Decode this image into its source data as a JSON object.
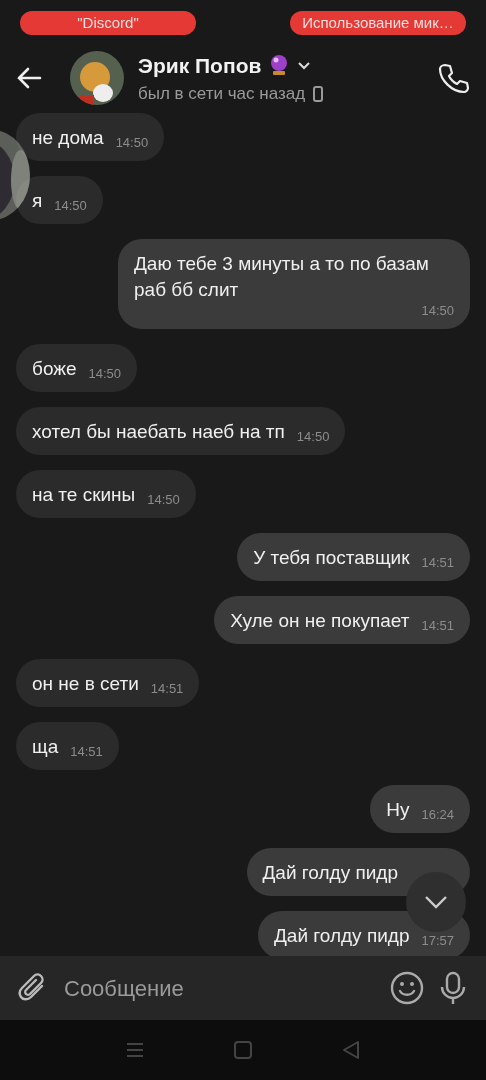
{
  "status_pills": [
    "\"Discord\"",
    "Использование мик…"
  ],
  "header": {
    "name": "Эрик Попов",
    "status": "был в сети час назад"
  },
  "messages": [
    {
      "text": "не дома",
      "time": "14:50",
      "outgoing": false
    },
    {
      "text": "я",
      "time": "14:50",
      "outgoing": false
    },
    {
      "text": "Даю тебе 3 минуты а то по базам раб бб слит",
      "time": "14:50",
      "outgoing": true
    },
    {
      "text": "боже",
      "time": "14:50",
      "outgoing": false
    },
    {
      "text": "хотел бы наебать наеб на тп",
      "time": "14:50",
      "outgoing": false
    },
    {
      "text": "на те скины",
      "time": "14:50",
      "outgoing": false
    },
    {
      "text": "У тебя поставщик",
      "time": "14:51",
      "outgoing": true
    },
    {
      "text": "Хуле он не покупает",
      "time": "14:51",
      "outgoing": true
    },
    {
      "text": "он не в сети",
      "time": "14:51",
      "outgoing": false
    },
    {
      "text": "ща",
      "time": "14:51",
      "outgoing": false
    },
    {
      "text": "Ну",
      "time": "16:24",
      "outgoing": true
    },
    {
      "text": "Дай голду пидр",
      "outgoing": true
    },
    {
      "text": "Дай голду пидр",
      "time": "17:57",
      "outgoing": true
    }
  ],
  "composer": {
    "placeholder": "Сообщение"
  }
}
